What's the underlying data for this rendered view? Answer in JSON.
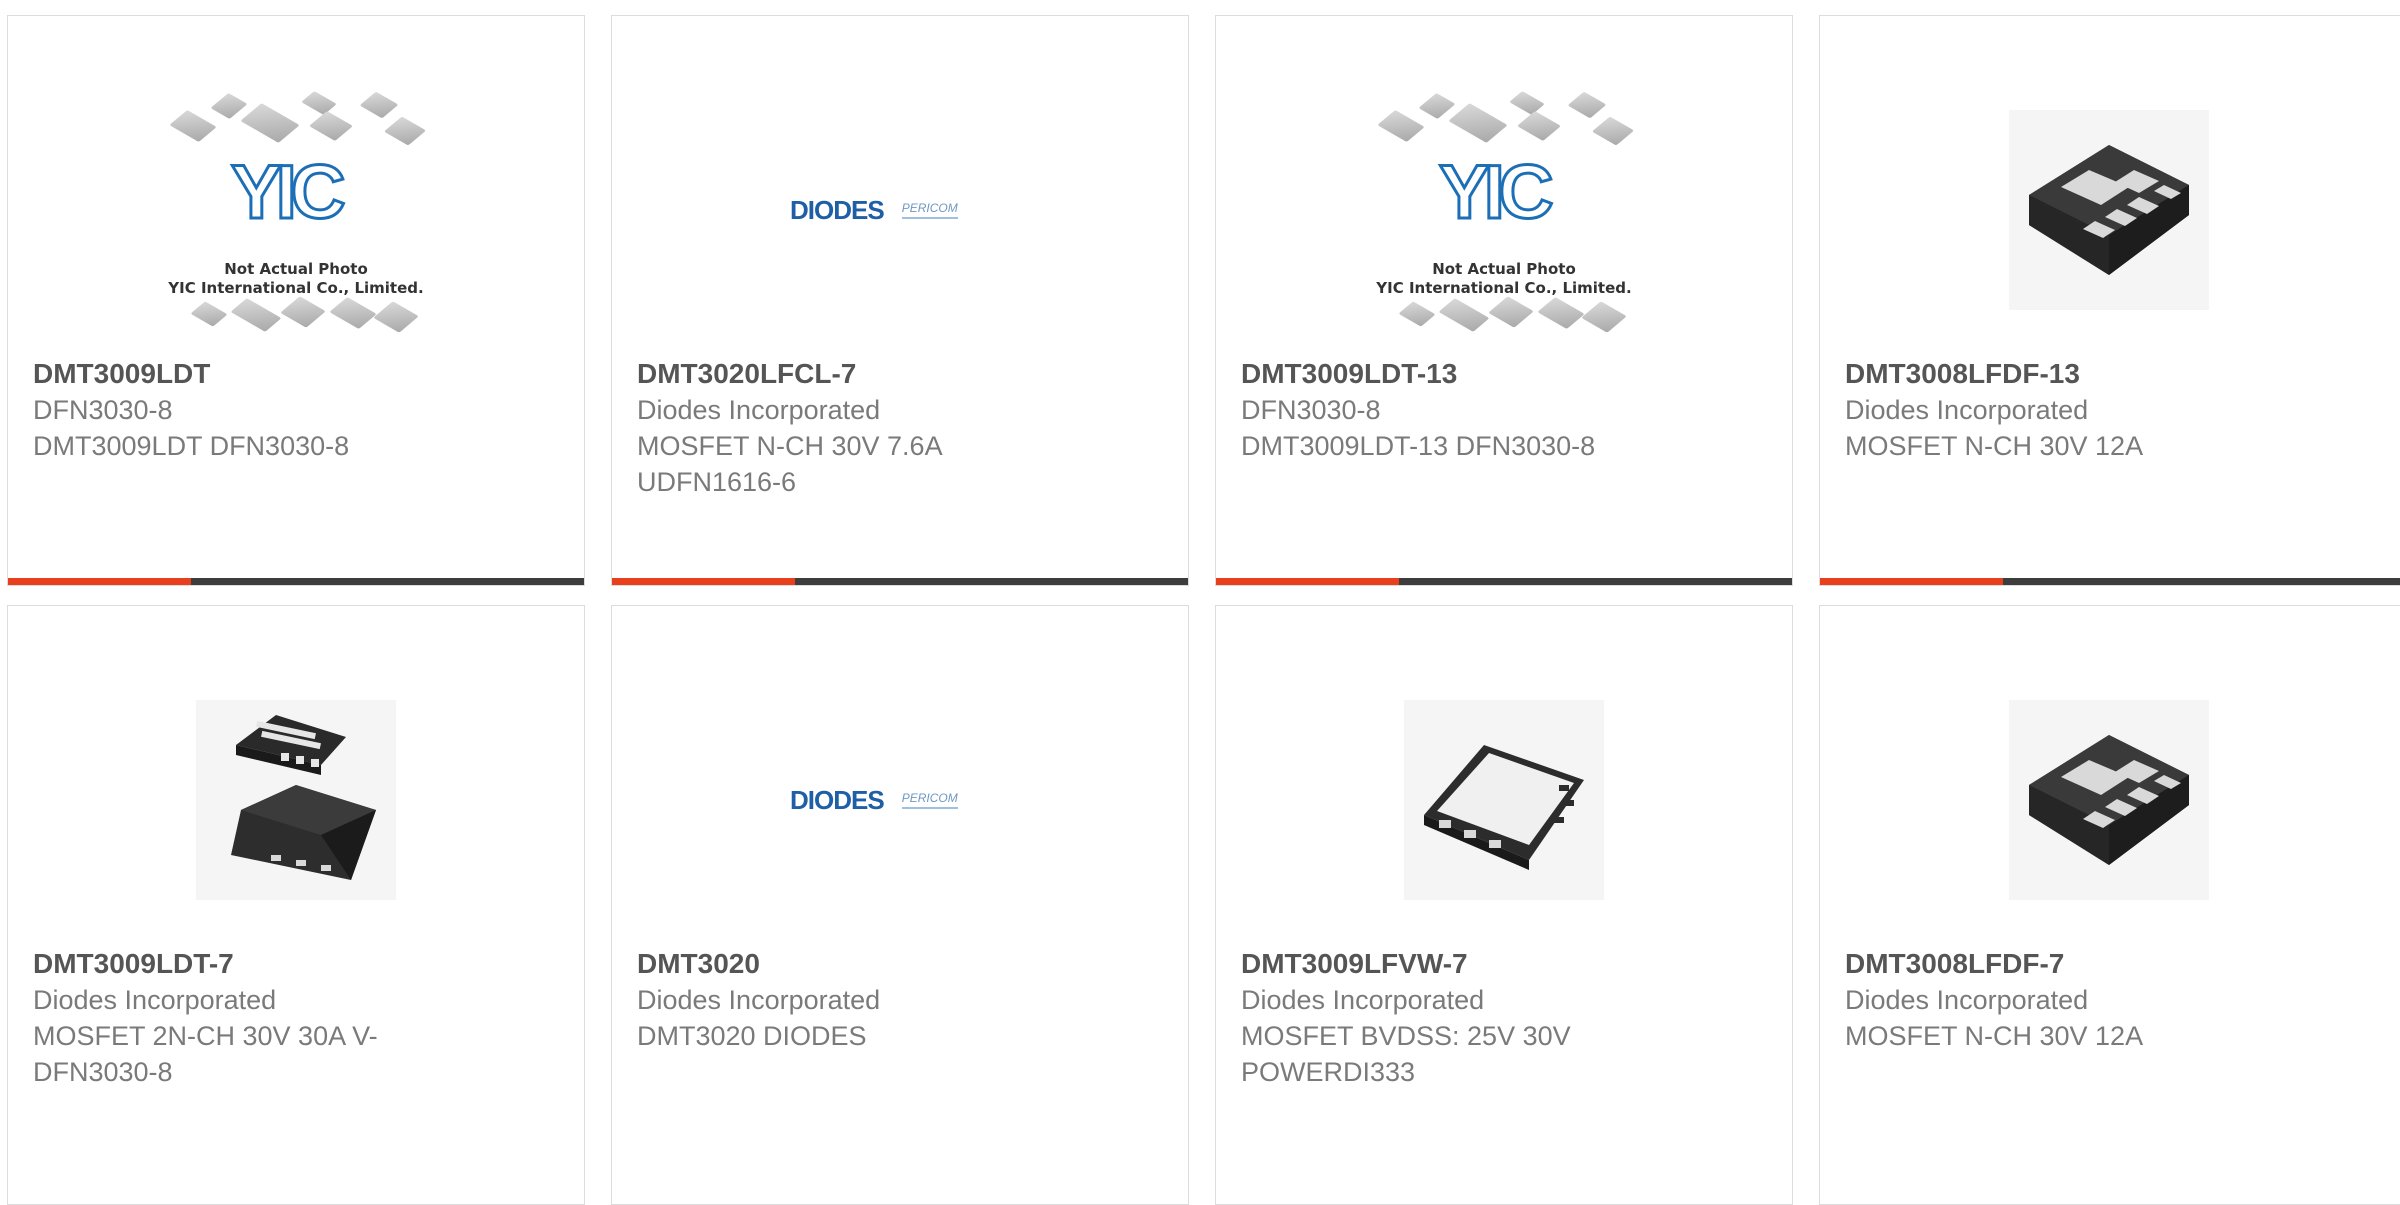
{
  "products": [
    {
      "part_number": "DMT3009LDT",
      "lines": [
        "DFN3030-8",
        "DMT3009LDT DFN3030-8"
      ],
      "image": "yic-placeholder",
      "image_caption": [
        "Not Actual Photo",
        "YIC International Co., Limited."
      ],
      "image_logo": "YIC"
    },
    {
      "part_number": "DMT3020LFCL-7",
      "lines": [
        "Diodes Incorporated",
        "MOSFET N-CH 30V 7.6A",
        "UDFN1616-6"
      ],
      "image": "diodes-logo",
      "image_logo": "DIODES",
      "image_logo2": "PERICOM"
    },
    {
      "part_number": "DMT3009LDT-13",
      "lines": [
        "DFN3030-8",
        "DMT3009LDT-13 DFN3030-8"
      ],
      "image": "yic-placeholder",
      "image_caption": [
        "Not Actual Photo",
        "YIC International Co., Limited."
      ],
      "image_logo": "YIC"
    },
    {
      "part_number": "DMT3008LFDF-13",
      "lines": [
        "Diodes Incorporated",
        "MOSFET N-CH 30V 12A"
      ],
      "image": "udfn-package"
    },
    {
      "part_number": "DMT3009LDT-7",
      "lines": [
        "Diodes Incorporated",
        "MOSFET 2N-CH 30V 30A V-",
        "DFN3030-8"
      ],
      "image": "dfn-package"
    },
    {
      "part_number": "DMT3020",
      "lines": [
        "Diodes Incorporated",
        "DMT3020 DIODES"
      ],
      "image": "diodes-logo",
      "image_logo": "DIODES",
      "image_logo2": "PERICOM"
    },
    {
      "part_number": "DMT3009LFVW-7",
      "lines": [
        "Diodes Incorporated",
        "MOSFET BVDSS: 25V 30V",
        "POWERDI333"
      ],
      "image": "powerdi-package"
    },
    {
      "part_number": "DMT3008LFDF-7",
      "lines": [
        "Diodes Incorporated",
        "MOSFET N-CH 30V 12A"
      ],
      "image": "udfn-package"
    }
  ],
  "colors": {
    "accent": "#e8401c",
    "bar": "#3d3d3d",
    "title": "#555555",
    "text": "#7a7a7a",
    "border": "#dcdcdc"
  }
}
